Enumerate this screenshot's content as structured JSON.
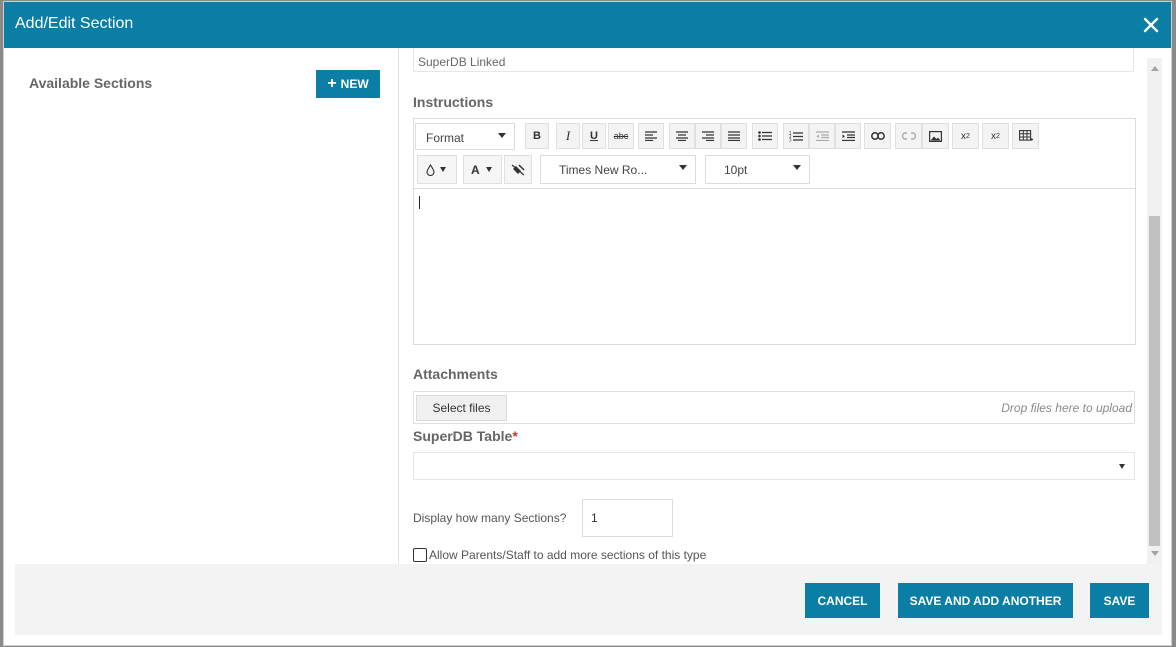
{
  "modal": {
    "title": "Add/Edit Section",
    "close_icon": "close-icon"
  },
  "left_panel": {
    "heading": "Available Sections",
    "new_button": {
      "icon": "plus-icon",
      "label": "NEW"
    }
  },
  "form": {
    "linked_text": "SuperDB Linked",
    "instructions_label": "Instructions",
    "editor": {
      "format_select": "Format",
      "font_name_select": "Times New Ro...",
      "font_size_select": "10pt",
      "buttons": {
        "bold": "B",
        "italic": "I",
        "underline": "U",
        "strikethrough": "abc",
        "font_color": "A"
      },
      "icons": [
        "bold-icon",
        "italic-icon",
        "underline-icon",
        "strikethrough-icon",
        "align-left-icon",
        "align-center-icon",
        "align-right-icon",
        "align-justify-icon",
        "bulleted-list-icon",
        "numbered-list-icon",
        "outdent-icon",
        "indent-icon",
        "link-icon",
        "unlink-icon",
        "image-icon",
        "subscript-icon",
        "superscript-icon",
        "table-icon",
        "background-color-icon",
        "font-color-icon",
        "clear-formatting-icon"
      ]
    },
    "attachments_label": "Attachments",
    "select_files_label": "Select files",
    "drop_hint": "Drop files here to upload",
    "superdb_table_label": "SuperDB Table",
    "required_marker": "*",
    "superdb_table_value": "",
    "display_count_label": "Display how many Sections?",
    "display_count_value": "1",
    "allow_more_label": "Allow Parents/Staff to add more sections of this type",
    "allow_more_checked": false
  },
  "footer": {
    "cancel_label": "CANCEL",
    "save_add_label": "SAVE AND ADD ANOTHER",
    "save_label": "SAVE"
  },
  "colors": {
    "accent": "#0a7ea4",
    "required": "#c0392b"
  }
}
